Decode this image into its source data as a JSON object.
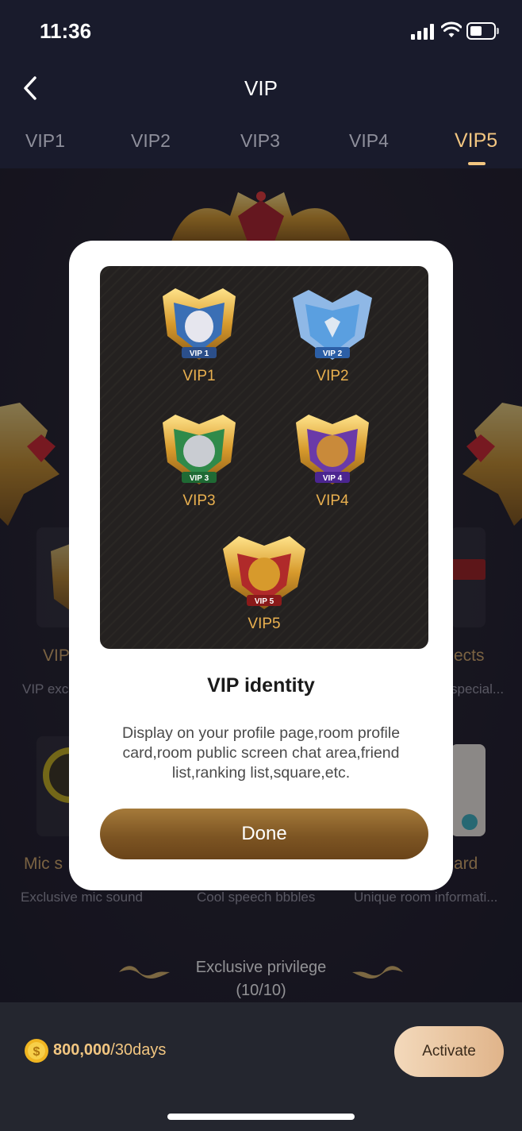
{
  "status_bar": {
    "time": "11:36"
  },
  "nav": {
    "title": "VIP"
  },
  "tabs": [
    {
      "label": "VIP1"
    },
    {
      "label": "VIP2"
    },
    {
      "label": "VIP3"
    },
    {
      "label": "VIP4"
    },
    {
      "label": "VIP5",
      "active": true
    }
  ],
  "background": {
    "features": [
      {
        "title": "VIP",
        "desc": "VIP exc"
      },
      {
        "title": "ects",
        "desc": "special..."
      },
      {
        "title": "Mic s",
        "desc": "Exclusive mic sound"
      },
      {
        "title": "",
        "desc": "Cool speech bbbles"
      },
      {
        "title": "ard",
        "desc": "Unique room informati..."
      }
    ],
    "privilege": {
      "title": "Exclusive privilege",
      "count": "(10/10)"
    }
  },
  "modal": {
    "badges": [
      {
        "label": "VIP1",
        "plate": "VIP 1",
        "color": "#3a6fb5"
      },
      {
        "label": "VIP2",
        "plate": "VIP 2",
        "color": "#5a9fe0"
      },
      {
        "label": "VIP3",
        "plate": "VIP 3",
        "color": "#2f8a4a"
      },
      {
        "label": "VIP4",
        "plate": "VIP 4",
        "color": "#6a3aa8"
      },
      {
        "label": "VIP5",
        "plate": "VIP 5",
        "color": "#b02a2a"
      }
    ],
    "title": "VIP identity",
    "description": "Display on your profile page,room profile card,room public screen chat area,friend list,ranking list,square,etc.",
    "done_label": "Done"
  },
  "purchase": {
    "amount": "800,000",
    "period": "/30days",
    "activate_label": "Activate"
  },
  "colors": {
    "accent_gold": "#f2c681",
    "done_button": "#8a602c",
    "background": "#191b2c"
  }
}
